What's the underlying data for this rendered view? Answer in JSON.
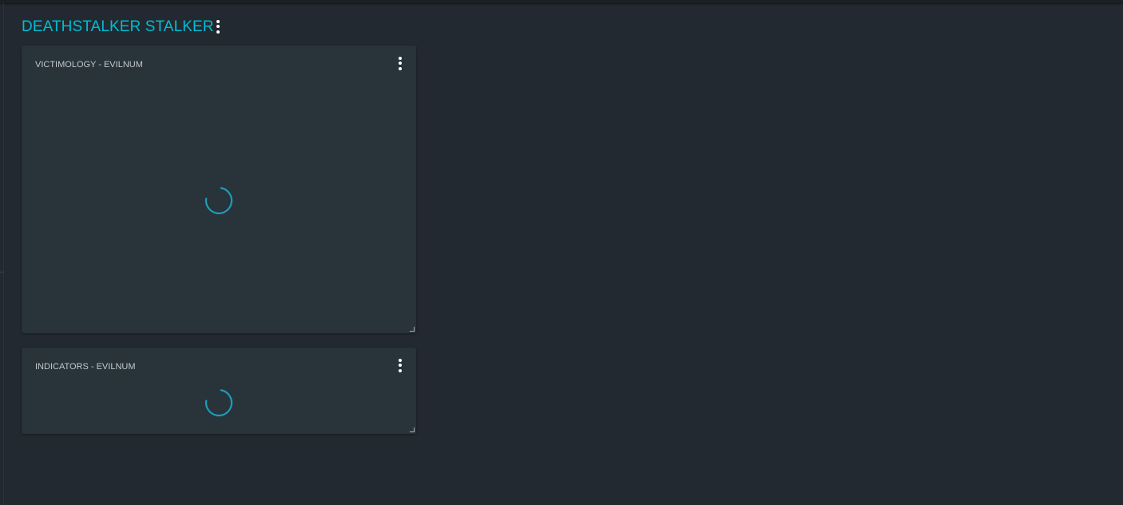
{
  "dashboard": {
    "title": "DEATHSTALKER STALKER",
    "menu_icon": "more-vert-icon"
  },
  "widgets": [
    {
      "title": "VICTIMOLOGY - EVILNUM",
      "menu_icon": "more-vert-icon",
      "state": "loading"
    },
    {
      "title": "INDICATORS - EVILNUM",
      "menu_icon": "more-vert-icon",
      "state": "loading"
    }
  ],
  "colors": {
    "background": "#222930",
    "panel": "#28333a",
    "accent": "#00bcd4",
    "spinner": "#1c9cb8",
    "text_muted": "#c4c8cb"
  }
}
